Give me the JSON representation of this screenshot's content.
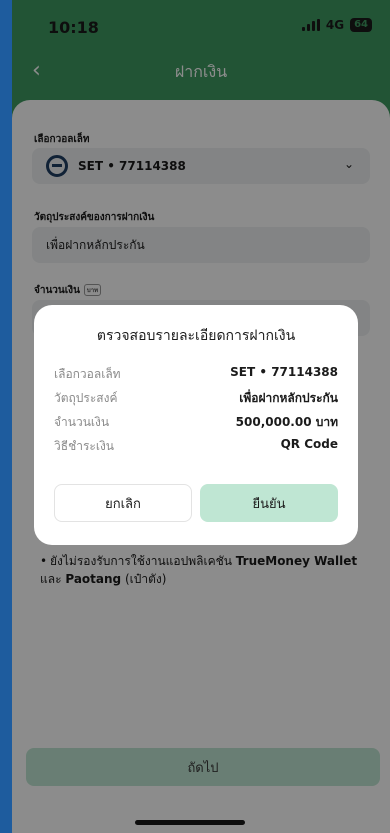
{
  "status_bar": {
    "time": "10:18",
    "network": "4G",
    "battery": "64"
  },
  "header": {
    "title": "ฝากเงิน"
  },
  "form": {
    "wallet_label": "เลือกวอลเล็ท",
    "wallet_value": "SET • 77114388",
    "purpose_label": "วัตถุประสงค์ของการฝากเงิน",
    "purpose_value": "เพื่อฝากหลักประกัน",
    "amount_label": "จำนวนเงิน",
    "amount_unit": "บาท"
  },
  "note": {
    "text_prefix": "ยังไม่รองรับการใช้งานแอปพลิเคชัน ",
    "app1": "TrueMoney Wallet",
    "text_middle": " และ ",
    "app2": "Paotang",
    "text_suffix": " (เป๋าตัง)"
  },
  "next_button": {
    "label": "ถัดไป"
  },
  "dialog": {
    "title": "ตรวจสอบรายละเอียดการฝากเงิน",
    "rows": [
      {
        "label": "เลือกวอลเล็ท",
        "value": "SET • 77114388"
      },
      {
        "label": "วัตถุประสงค์",
        "value": "เพื่อฝากหลักประกัน"
      },
      {
        "label": "จำนวนเงิน",
        "value": "500,000.00 บาท"
      },
      {
        "label": "วิธีชำระเงิน",
        "value": "QR Code"
      }
    ],
    "cancel_label": "ยกเลิก",
    "confirm_label": "ยืนยัน"
  },
  "colors": {
    "brand_green": "#3e9a62",
    "button_mint": "#bfe6d3",
    "wallet_icon": "#1f3e63"
  }
}
